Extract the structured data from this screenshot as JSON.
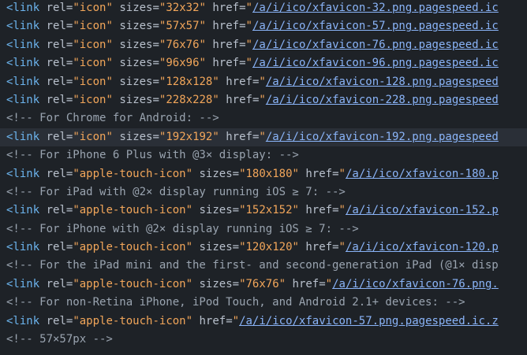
{
  "lines": [
    {
      "kind": "link",
      "rel": "icon",
      "sizes": "32x32",
      "href": "/a/i/ico/xfavicon-32.png.pagespeed.ic"
    },
    {
      "kind": "link",
      "rel": "icon",
      "sizes": "57x57",
      "href": "/a/i/ico/xfavicon-57.png.pagespeed.ic"
    },
    {
      "kind": "link",
      "rel": "icon",
      "sizes": "76x76",
      "href": "/a/i/ico/xfavicon-76.png.pagespeed.ic"
    },
    {
      "kind": "link",
      "rel": "icon",
      "sizes": "96x96",
      "href": "/a/i/ico/xfavicon-96.png.pagespeed.ic"
    },
    {
      "kind": "link",
      "rel": "icon",
      "sizes": "128x128",
      "href": "/a/i/ico/xfavicon-128.png.pagespeed"
    },
    {
      "kind": "link",
      "rel": "icon",
      "sizes": "228x228",
      "href": "/a/i/ico/xfavicon-228.png.pagespeed"
    },
    {
      "kind": "comment",
      "text": "<!-- For Chrome for Android: -->"
    },
    {
      "kind": "link",
      "rel": "icon",
      "sizes": "192x192",
      "href": "/a/i/ico/xfavicon-192.png.pagespeed",
      "highlight": true
    },
    {
      "kind": "comment",
      "text": "<!-- For iPhone 6 Plus with @3× display: -->"
    },
    {
      "kind": "link",
      "rel": "apple-touch-icon",
      "sizes": "180x180",
      "href": "/a/i/ico/xfavicon-180.p"
    },
    {
      "kind": "comment",
      "text": "<!-- For iPad with @2× display running iOS ≥ 7: -->"
    },
    {
      "kind": "link",
      "rel": "apple-touch-icon",
      "sizes": "152x152",
      "href": "/a/i/ico/xfavicon-152.p"
    },
    {
      "kind": "comment",
      "text": "<!-- For iPhone with @2× display running iOS ≥ 7: -->"
    },
    {
      "kind": "link",
      "rel": "apple-touch-icon",
      "sizes": "120x120",
      "href": "/a/i/ico/xfavicon-120.p"
    },
    {
      "kind": "comment",
      "text": "<!-- For the iPad mini and the first- and second-generation iPad (@1× disp"
    },
    {
      "kind": "link",
      "rel": "apple-touch-icon",
      "sizes": "76x76",
      "href": "/a/i/ico/xfavicon-76.png."
    },
    {
      "kind": "comment",
      "text": "<!-- For non-Retina iPhone, iPod Touch, and Android 2.1+ devices: -->"
    },
    {
      "kind": "link",
      "rel": "apple-touch-icon",
      "href": "/a/i/ico/xfavicon-57.png.pagespeed.ic.z"
    },
    {
      "kind": "comment",
      "text": "<!-- 57×57px -->"
    }
  ],
  "colors": {
    "background": "#1e2227",
    "highlight": "#2a2f37",
    "tag": "#6cb4ee",
    "string": "#f2a65a",
    "link": "#8ab4f8",
    "comment": "#9aa4b0"
  }
}
